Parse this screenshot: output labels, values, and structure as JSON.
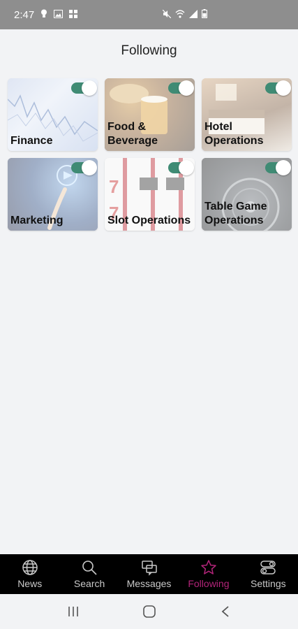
{
  "status_bar": {
    "time": "2:47"
  },
  "header": {
    "title": "Following"
  },
  "tiles": [
    {
      "label": "Finance",
      "toggle_on": true
    },
    {
      "label": "Food &\nBeverage",
      "toggle_on": true
    },
    {
      "label": "Hotel\nOperations",
      "toggle_on": true
    },
    {
      "label": "Marketing",
      "toggle_on": true
    },
    {
      "label": "Slot Operations",
      "toggle_on": true
    },
    {
      "label": "Table Game\nOperations",
      "toggle_on": true
    }
  ],
  "nav": {
    "items": [
      {
        "label": "News",
        "icon": "globe-icon"
      },
      {
        "label": "Search",
        "icon": "search-icon"
      },
      {
        "label": "Messages",
        "icon": "messages-icon"
      },
      {
        "label": "Following",
        "icon": "star-icon"
      },
      {
        "label": "Settings",
        "icon": "settings-toggle-icon"
      }
    ],
    "active_index": 3
  },
  "colors": {
    "accent": "#b3247a",
    "toggle_on": "#3f8b74",
    "status_bar": "#8e8e8e"
  }
}
